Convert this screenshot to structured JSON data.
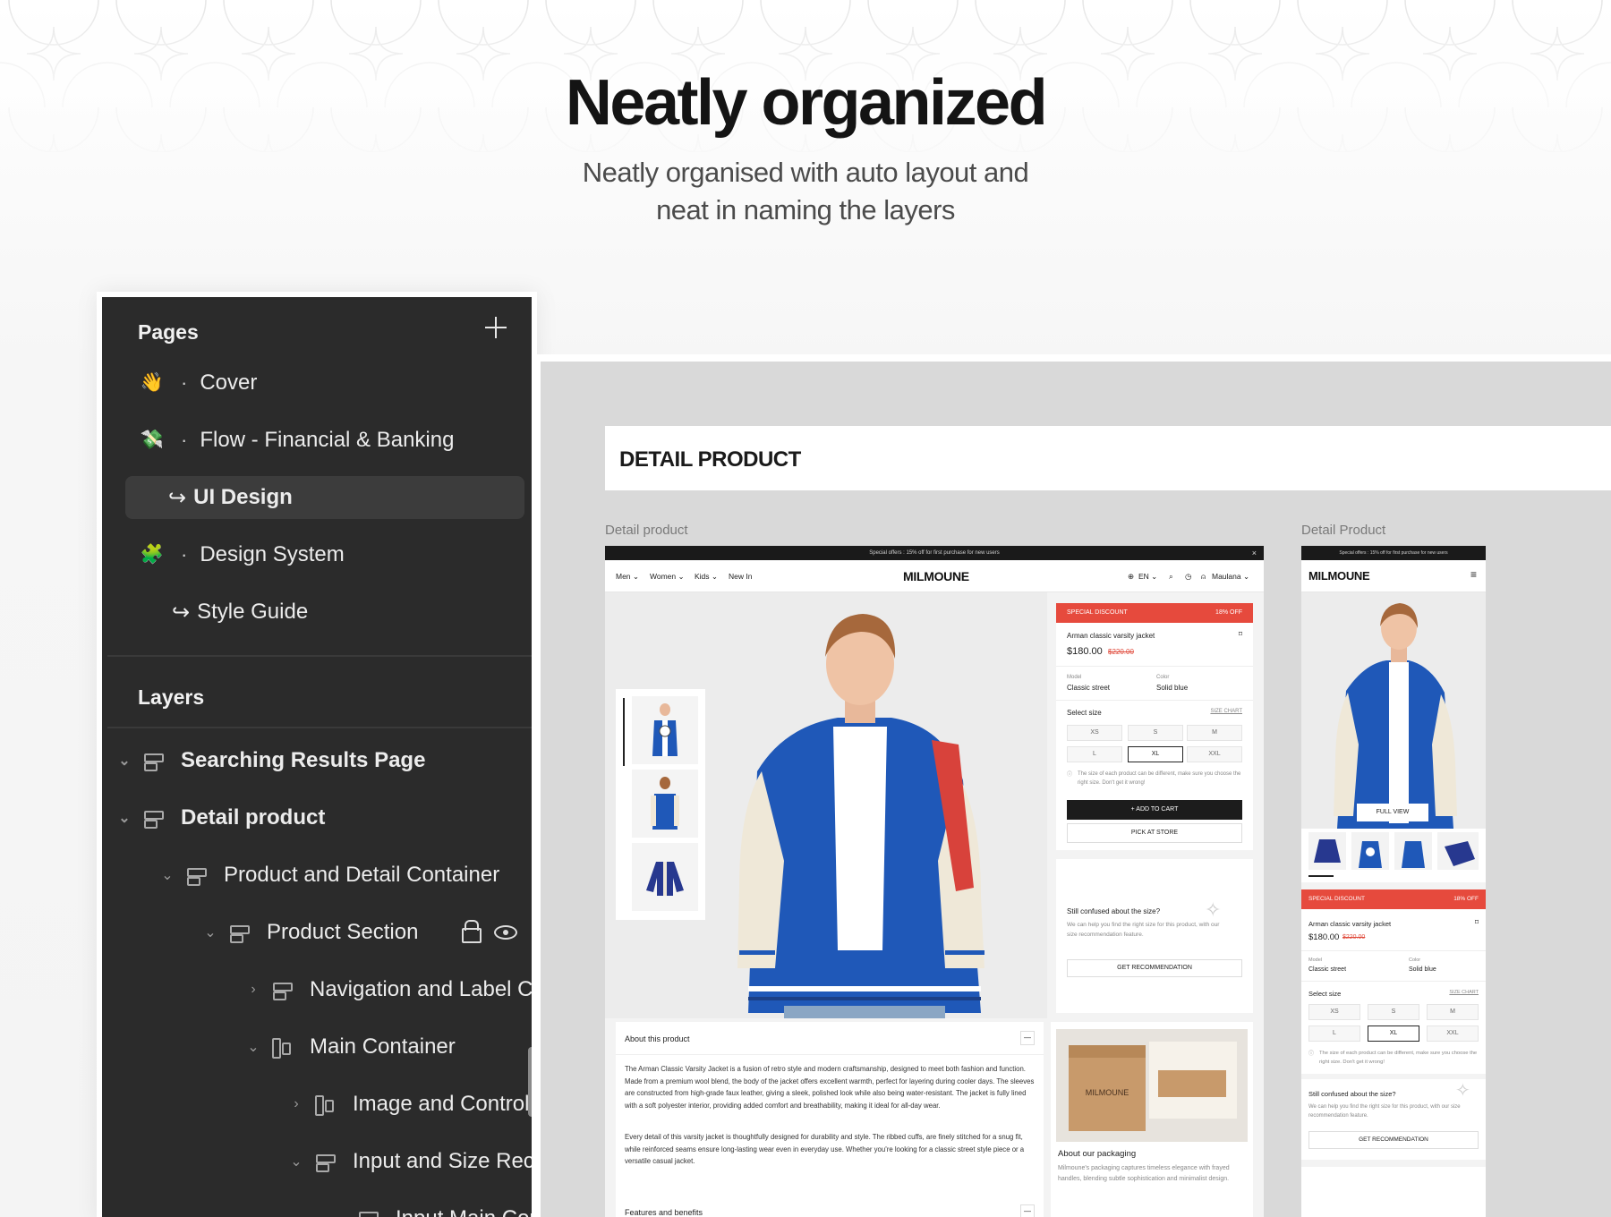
{
  "hero": {
    "title": "Neatly organized",
    "subtitle_line1": "Neatly organised with auto layout and",
    "subtitle_line2": "neat in naming the layers"
  },
  "pages_panel": {
    "title": "Pages",
    "items": [
      {
        "emoji": "👋",
        "label": "Cover"
      },
      {
        "emoji": "💸",
        "label": "Flow - Financial & Banking"
      },
      {
        "arrow": "↪",
        "label": "UI Design",
        "active": true
      },
      {
        "emoji": "🧩",
        "label": "Design System"
      },
      {
        "arrow": "↪",
        "label": "Style Guide"
      }
    ]
  },
  "layers_panel": {
    "title": "Layers",
    "items": [
      {
        "label": "Searching Results Page"
      },
      {
        "label": "Detail product"
      },
      {
        "label": "Product and Detail Container"
      },
      {
        "label": "Product Section"
      },
      {
        "label": "Navigation and Label Co"
      },
      {
        "label": "Main Container"
      },
      {
        "label": "Image and Control"
      },
      {
        "label": "Input and Size Reco"
      },
      {
        "label": "Input Main Con"
      }
    ]
  },
  "canvas": {
    "header": "DETAIL PRODUCT",
    "desktop_label": "Detail product",
    "mobile_label": "Detail Product"
  },
  "desktop": {
    "promo": "Special offers : 15% off for first purchase for new users",
    "close": "×",
    "nav": [
      "Men ⌄",
      "Women ⌄",
      "Kids ⌄",
      "New In"
    ],
    "brand": "MILMOUNE",
    "lang": "EN ⌄",
    "user": "Maulana ⌄",
    "discount_label": "SPECIAL DISCOUNT",
    "discount_value": "18% OFF",
    "product_name": "Arman classic varsity jacket",
    "price": "$180.00",
    "old_price": "$220.00",
    "model_label": "Model",
    "model_value": "Classic street",
    "color_label": "Color",
    "color_value": "Solid blue",
    "select_size": "Select size",
    "size_chart": "SIZE CHART",
    "sizes": [
      "XS",
      "S",
      "M",
      "L",
      "XL",
      "XXL"
    ],
    "size_note": "The size of each product can be different, make sure you choose the right size. Don't get it wrong!",
    "add_to_cart": "+ ADD TO CART",
    "pick_at_store": "PICK AT STORE",
    "confused_title": "Still confused about the size?",
    "confused_text": "We can help you find the right size for this product, with our size recommendation feature.",
    "get_recommendation": "GET RECOMMENDATION",
    "about_title": "About this product",
    "about_p1": "The Arman Classic Varsity Jacket is a fusion of retro style and modern craftsmanship, designed to meet both fashion and function. Made from a premium wool blend, the body of the jacket offers excellent warmth, perfect for layering during cooler days. The sleeves are constructed from high-grade faux leather, giving a sleek, polished look while also being water-resistant. The jacket is fully lined with a soft polyester interior, providing added comfort and breathability, making it ideal for all-day wear.",
    "about_p2": "Every detail of this varsity jacket is thoughtfully designed for durability and style. The ribbed cuffs, are finely stitched for a snug fit, while reinforced seams ensure long-lasting wear even in everyday use. Whether you're looking for a classic street style piece or a versatile casual jacket.",
    "packaging_title": "About our packaging",
    "packaging_text": "Milmoune's packaging captures timeless elegance with frayed handles, blending subtle sophistication and minimalist design.",
    "features_title": "Features and benefits",
    "box_brand": "MILMOUNE",
    "minus": "—"
  },
  "mobile": {
    "promo": "Special offers : 15% off for first purchase for new users",
    "brand": "MILMOUNE",
    "full_view": "FULL VIEW",
    "discount_label": "SPECIAL DISCOUNT",
    "discount_value": "18% OFF",
    "product_name": "Arman classic varsity jacket",
    "price": "$180.00",
    "old_price": "$220.00",
    "model_label": "Model",
    "model_value": "Classic street",
    "color_label": "Color",
    "color_value": "Solid blue",
    "select_size": "Select size",
    "size_chart": "SIZE CHART",
    "sizes": [
      "XS",
      "S",
      "M",
      "L",
      "XL",
      "XXL"
    ],
    "size_note": "The size of each product can be different, make sure you choose the right size. Don't get it wrong!",
    "confused_title": "Still confused about the size?",
    "confused_text": "We can help you find the right size for this product, with our size recommendation feature.",
    "get_recommendation": "GET RECOMMENDATION"
  },
  "colors": {
    "panel_bg": "#2b2b2b",
    "accent_red": "#e64a3d",
    "jacket_blue": "#1f58b8",
    "jacket_cream": "#efe8d8"
  }
}
